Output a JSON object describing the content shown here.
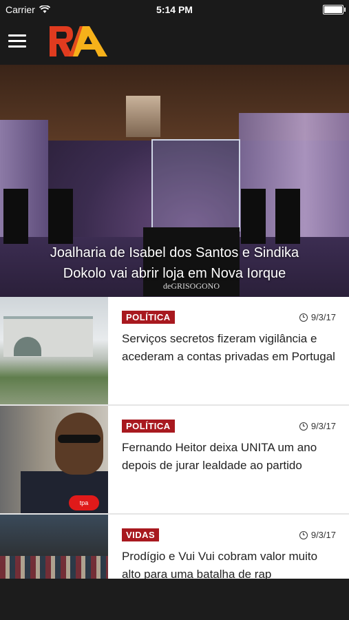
{
  "status_bar": {
    "carrier": "Carrier",
    "time": "5:14 PM",
    "battery_level": 1.0
  },
  "nav": {
    "logo_text": "RA",
    "menu_icon": "hamburger-icon"
  },
  "hero": {
    "caption_line1": "Joalharia de Isabel dos Santos e Sindika",
    "caption_line2": "Dokolo vai abrir loja em Nova Iorque",
    "image_text": "deGRISOGONO"
  },
  "articles": [
    {
      "category": "POLÍTICA",
      "date": "9/3/17",
      "title": "Serviços secretos fizeram vigilância e acederam a contas privadas em Portugal"
    },
    {
      "category": "POLÍTICA",
      "date": "9/3/17",
      "title": "Fernando Heitor deixa UNITA um ano depois de jurar lealdade ao partido",
      "image_text": "tpa"
    },
    {
      "category": "VIDAS",
      "date": "9/3/17",
      "title": "Prodígio e Vui Vui cobram valor muito alto para uma batalha de rap"
    }
  ],
  "colors": {
    "tag": "#a8191f",
    "bar": "#1a1a1a",
    "logo_red": "#e03b1f",
    "logo_yellow": "#f6b11a"
  }
}
